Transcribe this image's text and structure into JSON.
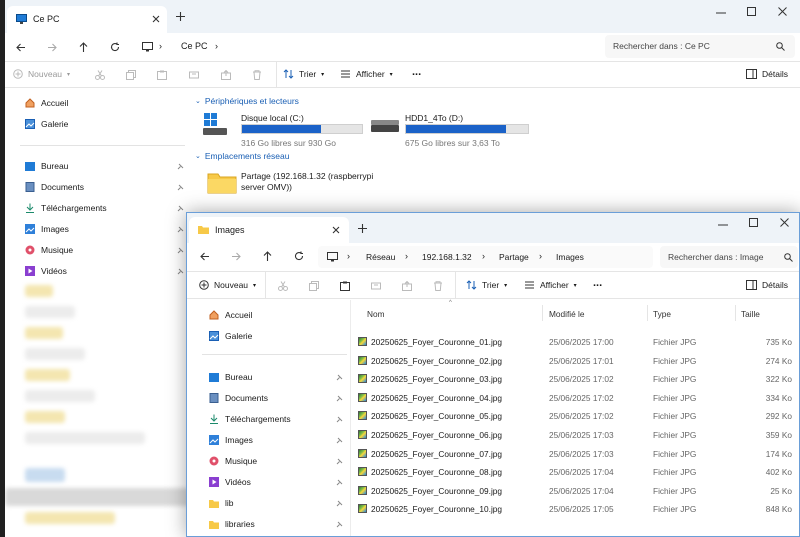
{
  "win1": {
    "tab_title": "Ce PC",
    "address": "Ce PC",
    "search_placeholder": "Rechercher dans : Ce PC",
    "toolbar": {
      "new": "Nouveau",
      "sort": "Trier",
      "view": "Afficher",
      "more": "...",
      "details": "Détails"
    },
    "nav": {
      "top": [
        "Accueil",
        "Galerie"
      ],
      "pinned": [
        "Bureau",
        "Documents",
        "Téléchargements",
        "Images",
        "Musique",
        "Vidéos"
      ]
    },
    "sections": {
      "devices": "Périphériques et lecteurs",
      "network": "Emplacements réseau"
    },
    "drives": [
      {
        "name": "Disque local (C:)",
        "free": "316 Go libres sur 930 Go",
        "used_fraction": 0.66
      },
      {
        "name": "HDD1_4To (D:)",
        "free": "675 Go libres sur 3,63 To",
        "used_fraction": 0.82
      }
    ],
    "network_location": {
      "line1": "Partage (192.168.1.32 (raspberrypi",
      "line2": "server OMV))"
    }
  },
  "win2": {
    "tab_title": "Images",
    "breadcrumb": [
      "Réseau",
      "192.168.1.32",
      "Partage",
      "Images"
    ],
    "search_placeholder": "Rechercher dans : Image",
    "toolbar": {
      "new": "Nouveau",
      "sort": "Trier",
      "view": "Afficher",
      "more": "...",
      "details": "Détails"
    },
    "nav": {
      "top": [
        "Accueil",
        "Galerie"
      ],
      "pinned": [
        "Bureau",
        "Documents",
        "Téléchargements",
        "Images",
        "Musique",
        "Vidéos",
        "lib",
        "libraries"
      ]
    },
    "columns": {
      "name": "Nom",
      "modified": "Modifié le",
      "type": "Type",
      "size": "Taille"
    },
    "files": [
      {
        "name": "20250625_Foyer_Couronne_01.jpg",
        "modified": "25/06/2025 17:00",
        "type": "Fichier JPG",
        "size": "735 Ko"
      },
      {
        "name": "20250625_Foyer_Couronne_02.jpg",
        "modified": "25/06/2025 17:01",
        "type": "Fichier JPG",
        "size": "274 Ko"
      },
      {
        "name": "20250625_Foyer_Couronne_03.jpg",
        "modified": "25/06/2025 17:02",
        "type": "Fichier JPG",
        "size": "322 Ko"
      },
      {
        "name": "20250625_Foyer_Couronne_04.jpg",
        "modified": "25/06/2025 17:02",
        "type": "Fichier JPG",
        "size": "334 Ko"
      },
      {
        "name": "20250625_Foyer_Couronne_05.jpg",
        "modified": "25/06/2025 17:02",
        "type": "Fichier JPG",
        "size": "292 Ko"
      },
      {
        "name": "20250625_Foyer_Couronne_06.jpg",
        "modified": "25/06/2025 17:03",
        "type": "Fichier JPG",
        "size": "359 Ko"
      },
      {
        "name": "20250625_Foyer_Couronne_07.jpg",
        "modified": "25/06/2025 17:03",
        "type": "Fichier JPG",
        "size": "174 Ko"
      },
      {
        "name": "20250625_Foyer_Couronne_08.jpg",
        "modified": "25/06/2025 17:04",
        "type": "Fichier JPG",
        "size": "402 Ko"
      },
      {
        "name": "20250625_Foyer_Couronne_09.jpg",
        "modified": "25/06/2025 17:04",
        "type": "Fichier JPG",
        "size": "25 Ko"
      },
      {
        "name": "20250625_Foyer_Couronne_10.jpg",
        "modified": "25/06/2025 17:05",
        "type": "Fichier JPG",
        "size": "848 Ko"
      }
    ]
  }
}
